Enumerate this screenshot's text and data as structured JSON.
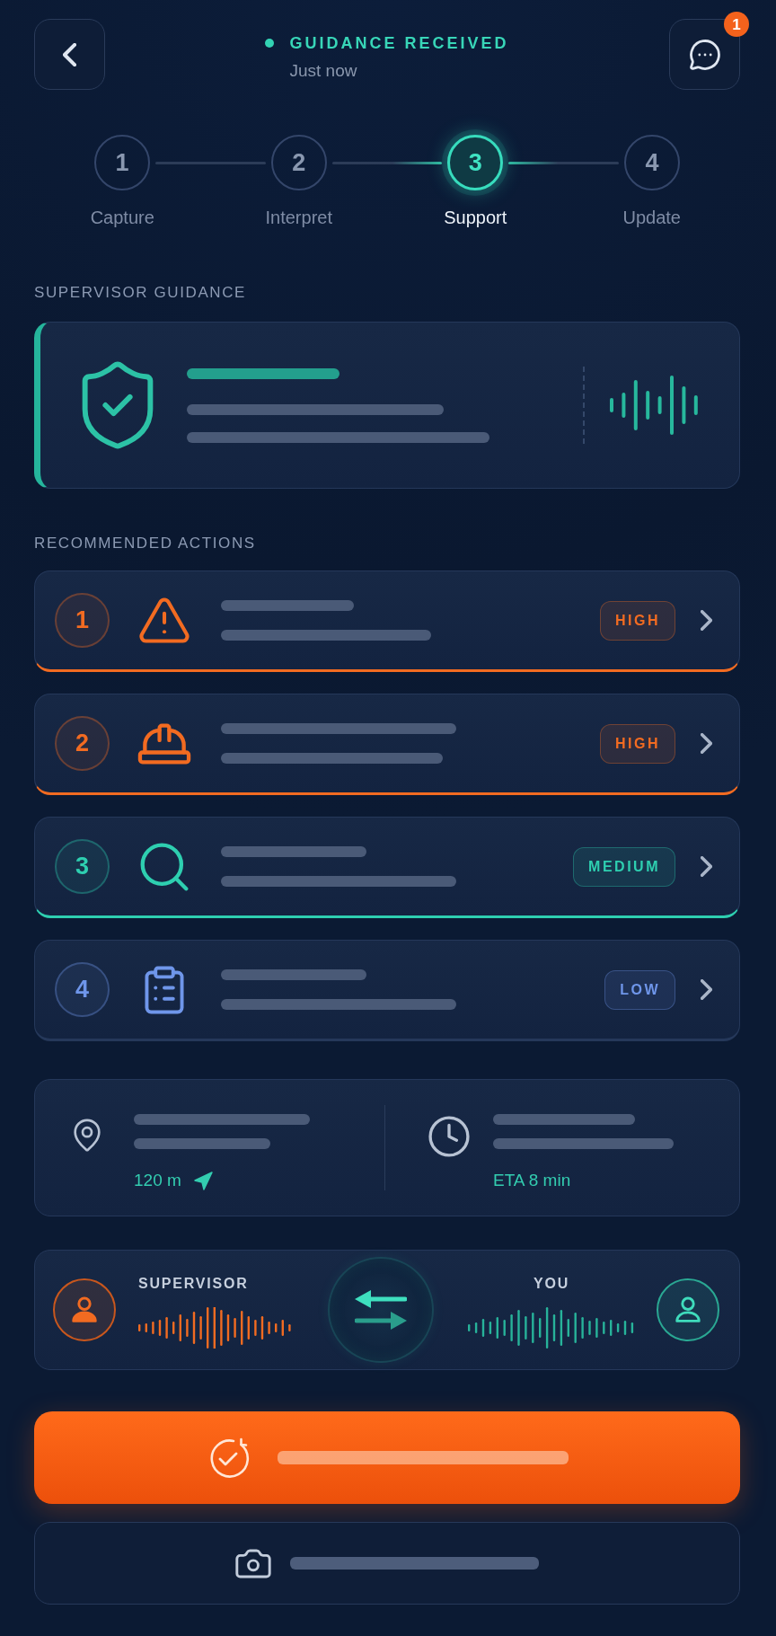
{
  "header": {
    "status": "GUIDANCE RECEIVED",
    "time": "Just now",
    "notification_count": "1"
  },
  "steps": [
    {
      "number": "1",
      "label": "Capture",
      "selected": false
    },
    {
      "number": "2",
      "label": "Interpret",
      "selected": false
    },
    {
      "number": "3",
      "label": "Support",
      "selected": true
    },
    {
      "number": "4",
      "label": "Update",
      "selected": false
    }
  ],
  "guidance": {
    "title": "SUPERVISOR GUIDANCE"
  },
  "actions": {
    "title": "RECOMMENDED ACTIONS",
    "items": [
      {
        "number": "1",
        "priority": "HIGH",
        "color": "#f26b21",
        "accent": true
      },
      {
        "number": "2",
        "priority": "HIGH",
        "color": "#f26b21",
        "accent": true
      },
      {
        "number": "3",
        "priority": "MEDIUM",
        "color": "#2ecfb0",
        "accent": true
      },
      {
        "number": "4",
        "priority": "LOW",
        "color": "#6f96ea",
        "accent": false
      }
    ]
  },
  "location": {
    "distance": "120 m",
    "eta": "ETA 8 min"
  },
  "voice": {
    "supervisor_label": "SUPERVISOR",
    "you_label": "YOU"
  }
}
